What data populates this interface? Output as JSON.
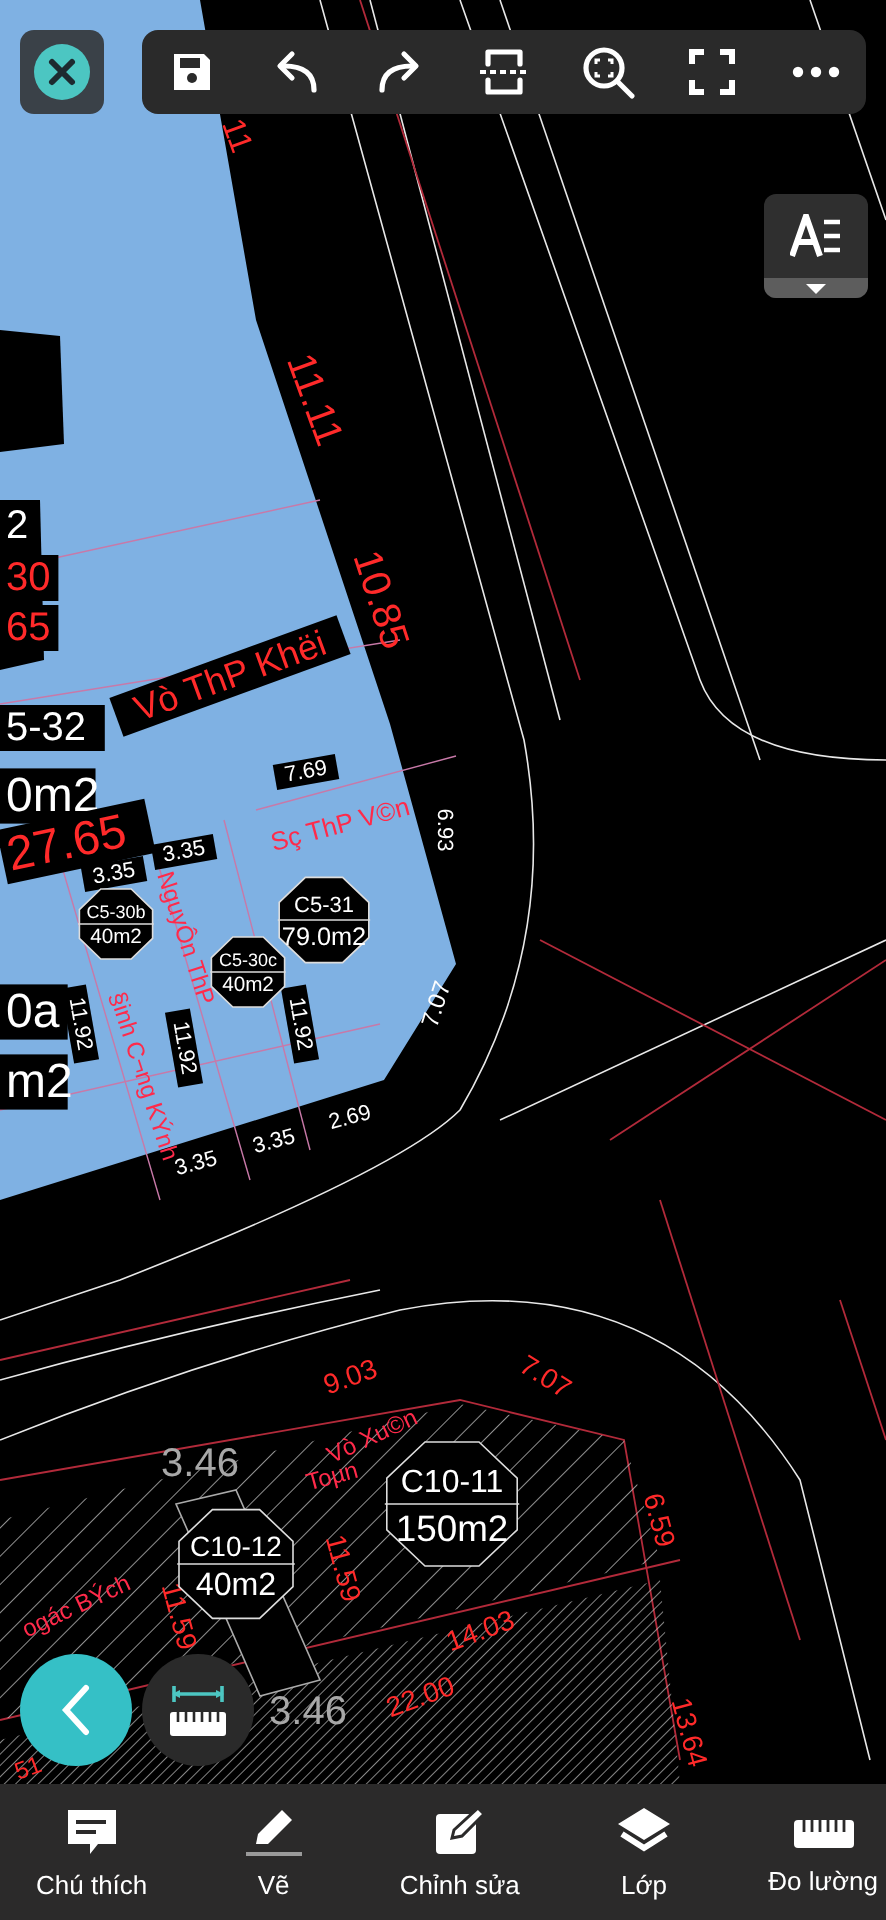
{
  "drawing": {
    "labels": [
      {
        "text": "11",
        "kind": "length"
      },
      {
        "text": "11.11",
        "kind": "length"
      },
      {
        "text": "10.85",
        "kind": "length"
      },
      {
        "text": "2",
        "kind": "tag"
      },
      {
        "text": "30",
        "kind": "band"
      },
      {
        "text": "65",
        "kind": "band"
      },
      {
        "text": "Vò ThP Khëi",
        "kind": "band"
      },
      {
        "text": "5-32",
        "kind": "tag"
      },
      {
        "text": "0m2",
        "kind": "tag"
      },
      {
        "text": "27.65",
        "kind": "band"
      },
      {
        "text": "7.69",
        "kind": "tag"
      },
      {
        "text": "3.35",
        "kind": "tag"
      },
      {
        "text": "3.35",
        "kind": "tag"
      },
      {
        "text": "Sç ThP V©n",
        "kind": "owner"
      },
      {
        "text": "6.93",
        "kind": "mark"
      },
      {
        "text": "11.92",
        "kind": "tag"
      },
      {
        "text": "11.92",
        "kind": "tag"
      },
      {
        "text": "11.92",
        "kind": "tag"
      },
      {
        "text": "NguyÔn ThP",
        "kind": "owner"
      },
      {
        "text": "§inh C¬ng KÝnh",
        "kind": "owner"
      },
      {
        "text": "7.07",
        "kind": "mark"
      },
      {
        "text": "0a",
        "kind": "tag"
      },
      {
        "text": "m2",
        "kind": "tag"
      },
      {
        "text": "3.35",
        "kind": "mark"
      },
      {
        "text": "3.35",
        "kind": "mark"
      },
      {
        "text": "2.69",
        "kind": "mark"
      },
      {
        "text": "9.03",
        "kind": "length"
      },
      {
        "text": "7.07",
        "kind": "length"
      },
      {
        "text": "6.59",
        "kind": "length"
      },
      {
        "text": "Vò Xu©n",
        "kind": "owner"
      },
      {
        "text": "Toµn",
        "kind": "owner"
      },
      {
        "text": "11.59",
        "kind": "length"
      },
      {
        "text": "11.59",
        "kind": "length"
      },
      {
        "text": "ogác BÝch",
        "kind": "owner"
      },
      {
        "text": "14.03",
        "kind": "length"
      },
      {
        "text": "22.00",
        "kind": "length"
      },
      {
        "text": "13.64",
        "kind": "length"
      },
      {
        "text": "3.46",
        "kind": "faint"
      },
      {
        "text": "3.46",
        "kind": "faint"
      },
      {
        "text": "51",
        "kind": "length"
      }
    ],
    "lots": [
      {
        "id": "C5-30b",
        "area": "40m2"
      },
      {
        "id": "C5-30c",
        "area": "40m2"
      },
      {
        "id": "C5-31",
        "area": "79.0m2"
      },
      {
        "id": "C10-12",
        "area": "40m2"
      },
      {
        "id": "C10-11",
        "area": "150m2"
      }
    ]
  },
  "bottom_nav": [
    {
      "label": "Chú thích",
      "kind": "note"
    },
    {
      "label": "Vẽ",
      "kind": "draw"
    },
    {
      "label": "Chỉnh sửa",
      "kind": "edit"
    },
    {
      "label": "Lớp",
      "kind": "layers"
    },
    {
      "label": "Đo lường",
      "kind": "measure"
    }
  ]
}
